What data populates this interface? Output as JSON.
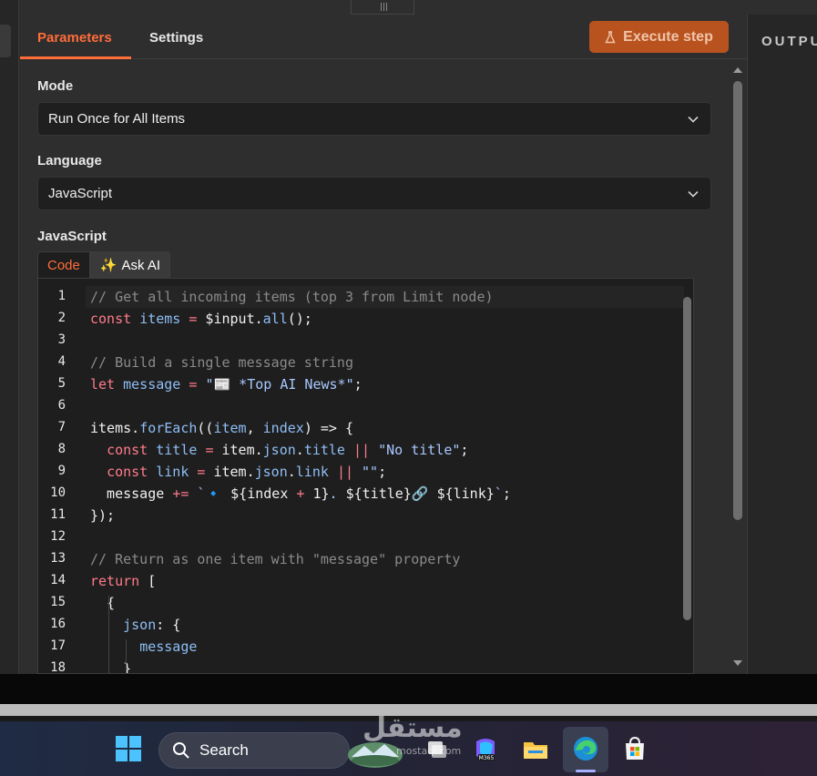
{
  "tabs": {
    "parameters": "Parameters",
    "settings": "Settings"
  },
  "execute_button": "Execute step",
  "mode": {
    "label": "Mode",
    "value": "Run Once for All Items"
  },
  "language": {
    "label": "Language",
    "value": "JavaScript"
  },
  "code_section": {
    "label": "JavaScript",
    "tab_code": "Code",
    "tab_ask_ai": "Ask AI"
  },
  "output_panel": {
    "title": "OUTPUT"
  },
  "code_lines": [
    {
      "n": "1",
      "html": "<span class='cm'>// Get all incoming items (top 3 from Limit node)</span>"
    },
    {
      "n": "2",
      "html": "<span class='kw'>const</span> <span class='var'>items</span> <span class='op'>=</span> $input.<span class='prop'>all</span>();"
    },
    {
      "n": "3",
      "html": ""
    },
    {
      "n": "4",
      "html": "<span class='cm'>// Build a single message string</span>"
    },
    {
      "n": "5",
      "html": "<span class='kw'>let</span> <span class='var'>message</span> <span class='op'>=</span> <span class='str'>\"📰 *Top AI News*\"</span>;"
    },
    {
      "n": "6",
      "html": ""
    },
    {
      "n": "7",
      "html": "items.<span class='prop'>forEach</span>((<span class='var'>item</span>, <span class='var'>index</span>) => {"
    },
    {
      "n": "8",
      "html": "  <span class='kw'>const</span> <span class='var'>title</span> <span class='op'>=</span> item.<span class='prop'>json</span>.<span class='prop'>title</span> <span class='op'>||</span> <span class='str'>\"No title\"</span>;"
    },
    {
      "n": "9",
      "html": "  <span class='kw'>const</span> <span class='var'>link</span> <span class='op'>=</span> item.<span class='prop'>json</span>.<span class='prop'>link</span> <span class='op'>||</span> <span class='str'>\"\"</span>;"
    },
    {
      "n": "10",
      "html": "  message <span class='op'>+=</span> <span class='str'>`🔹 </span>${index <span class='op'>+</span> 1}<span class='str'>. </span>${title}<span class='str'>🔗 </span>${link}<span class='str'>`</span>;"
    },
    {
      "n": "11",
      "html": "});"
    },
    {
      "n": "12",
      "html": ""
    },
    {
      "n": "13",
      "html": "<span class='cm'>// Return as one item with \"message\" property</span>"
    },
    {
      "n": "14",
      "html": "<span class='kw'>return</span> ["
    },
    {
      "n": "15",
      "html": "  {"
    },
    {
      "n": "16",
      "html": "    <span class='var'>json</span>: {"
    },
    {
      "n": "17",
      "html": "      <span class='var'>message</span>"
    },
    {
      "n": "18",
      "html": "    }"
    }
  ],
  "taskbar": {
    "search_label": "Search",
    "watermark_text": "مستقل",
    "watermark_sub": "mostaql.com"
  },
  "colors": {
    "accent": "#ff6d3a",
    "execute_bg": "#b8531f"
  }
}
